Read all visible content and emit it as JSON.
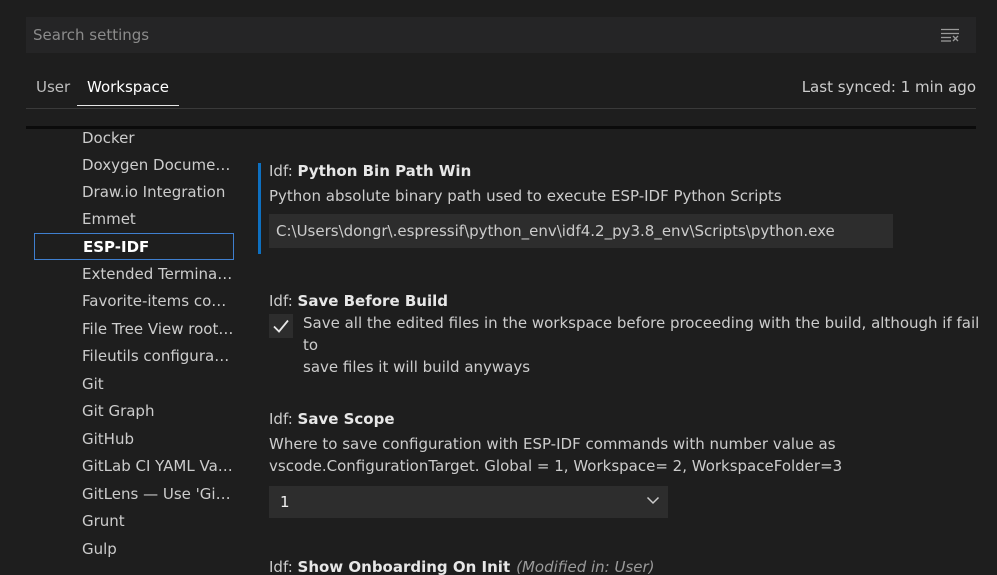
{
  "search": {
    "placeholder": "Search settings"
  },
  "tabs": [
    {
      "label": "User"
    },
    {
      "label": "Workspace"
    }
  ],
  "last_synced": "Last synced: 1 min ago",
  "toc": {
    "items": [
      "Docker",
      "Doxygen Documen...",
      "Draw.io Integration",
      "Emmet",
      "ESP-IDF",
      "Extended Terminal I...",
      "Favorite-items conf...",
      "File Tree View root ...",
      "Fileutils configurati...",
      "Git",
      "Git Graph",
      "GitHub",
      "GitLab CI YAML Vali...",
      "GitLens — Use 'Git...",
      "Grunt",
      "Gulp"
    ],
    "selected": "ESP-IDF"
  },
  "settings": {
    "python_bin_path": {
      "category": "Idf: ",
      "name": "Python Bin Path Win",
      "description": "Python absolute binary path used to execute ESP-IDF Python Scripts",
      "value": "C:\\Users\\dongr\\.espressif\\python_env\\idf4.2_py3.8_env\\Scripts\\python.exe"
    },
    "save_before_build": {
      "category": "Idf: ",
      "name": "Save Before Build",
      "checked": true,
      "description_line1": "Save all the edited files in the workspace before proceeding with the build, although if fail to",
      "description_line2": "save files it will build anyways"
    },
    "save_scope": {
      "category": "Idf: ",
      "name": "Save Scope",
      "description_line1": "Where to save configuration with ESP-IDF commands with number value as",
      "description_line2": "vscode.ConfigurationTarget. Global = 1, Workspace= 2, WorkspaceFolder=3",
      "value": "1"
    },
    "show_onboarding": {
      "category": "Idf: ",
      "name": "Show Onboarding On Init",
      "modified": "(Modified in: User)"
    }
  },
  "icons": {
    "clear_filter": "clear-filter-icon",
    "check": "check-icon",
    "chevron": "chevron-down-icon"
  },
  "colors": {
    "background": "#1e1e1e",
    "accent": "#0e70c0",
    "focus_border": "#3f7fcf"
  }
}
